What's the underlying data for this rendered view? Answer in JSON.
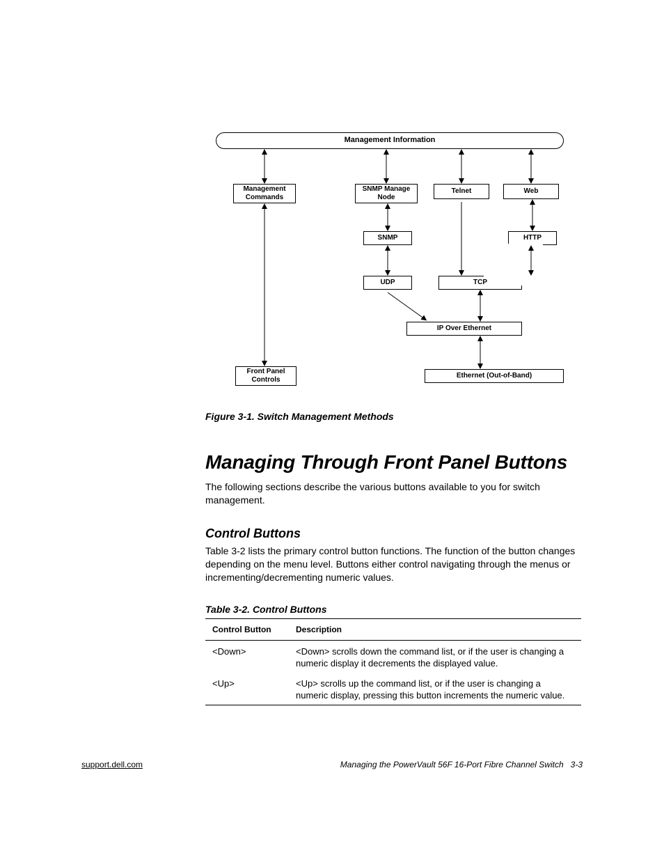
{
  "diagram": {
    "mgmt_info": "Management Information",
    "mgmt_commands": "Management\nCommands",
    "snmp_node": "SNMP Manage\nNode",
    "telnet": "Telnet",
    "web": "Web",
    "snmp": "SNMP",
    "http": "HTTP",
    "udp": "UDP",
    "tcp": "TCP",
    "ip": "IP Over Ethernet",
    "ethernet": "Ethernet (Out-of-Band)",
    "front_panel": "Front Panel\nControls"
  },
  "fig_caption": "Figure 3-1.  Switch Management Methods",
  "section_heading": "Managing Through Front Panel Buttons",
  "section_intro": "The following sections describe the various buttons available to you for switch management.",
  "subsection_heading": "Control Buttons",
  "subsection_body": "Table 3-2 lists the primary control button functions. The function of the button changes depending on the menu level. Buttons either control navigating through the menus or incrementing/decrementing numeric values.",
  "table_caption": "Table 3-2.  Control Buttons",
  "table": {
    "h1": "Control Button",
    "h2": "Description",
    "rows": [
      {
        "button": "<Down>",
        "desc": "<Down> scrolls down the command list, or if the user is changing a numeric display it decrements the displayed value."
      },
      {
        "button": "<Up>",
        "desc": "<Up> scrolls up the command list, or if the user is changing a numeric display, pressing this button increments the numeric value."
      }
    ]
  },
  "footer": {
    "link": "support.dell.com",
    "title": "Managing the PowerVault 56F 16-Port Fibre Channel Switch",
    "page": "3-3"
  }
}
